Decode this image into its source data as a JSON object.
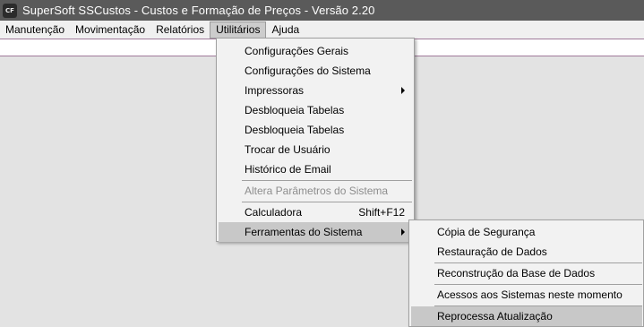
{
  "window": {
    "icon_text": "CF",
    "title": "SuperSoft SSCustos - Custos e Formação de Preços - Versão 2.20"
  },
  "menubar": {
    "items": [
      {
        "label": "Manutenção"
      },
      {
        "label": "Movimentação"
      },
      {
        "label": "Relatórios"
      },
      {
        "label": "Utilitários"
      },
      {
        "label": "Ajuda"
      }
    ]
  },
  "utilitarios_menu": {
    "items": [
      {
        "label": "Configurações Gerais"
      },
      {
        "label": "Configurações do Sistema"
      },
      {
        "label": "Impressoras"
      },
      {
        "label": "Desbloqueia Tabelas"
      },
      {
        "label": "Desbloqueia Tabelas"
      },
      {
        "label": "Trocar de Usuário"
      },
      {
        "label": "Histórico de Email"
      },
      {
        "label": "Altera Parâmetros do Sistema"
      },
      {
        "label": "Calculadora",
        "shortcut": "Shift+F12"
      },
      {
        "label": "Ferramentas do Sistema"
      }
    ]
  },
  "ferramentas_submenu": {
    "items": [
      {
        "label": "Cópia de Segurança"
      },
      {
        "label": "Restauração de Dados"
      },
      {
        "label": "Reconstrução da Base de Dados"
      },
      {
        "label": "Acessos aos Sistemas neste momento"
      },
      {
        "label": "Reprocessa Atualização"
      }
    ]
  }
}
